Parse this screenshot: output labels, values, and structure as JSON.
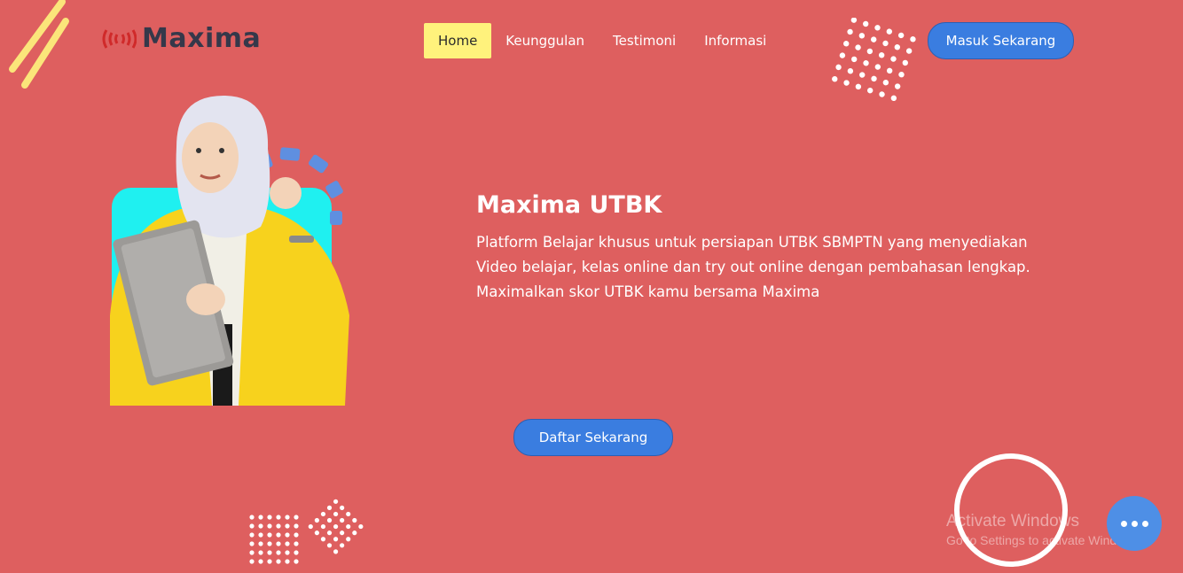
{
  "brand": {
    "name": "Maxima",
    "logo_icon": "sound-wave-icon"
  },
  "nav": {
    "items": [
      {
        "label": "Home",
        "active": true
      },
      {
        "label": "Keunggulan",
        "active": false
      },
      {
        "label": "Testimoni",
        "active": false
      },
      {
        "label": "Informasi",
        "active": false
      }
    ]
  },
  "header": {
    "login_label": "Masuk Sekarang"
  },
  "hero": {
    "title": "Maxima UTBK",
    "description": "Platform Belajar khusus untuk persiapan UTBK SBMPTN yang menyediakan Video belajar, kelas online dan try out online dengan pembahasan lengkap. Maximalkan skor UTBK kamu bersama Maxima",
    "cta_label": "Daftar Sekarang"
  },
  "watermark": {
    "line1": "Activate Windows",
    "line2": "Go to Settings to activate Windows."
  },
  "chat": {
    "icon": "more-dots-icon"
  },
  "colors": {
    "background": "#de5f5f",
    "accent_yellow": "#fff27c",
    "button_blue": "#3a7de0",
    "logo_dark": "#35384a",
    "logo_red": "#d02a2a",
    "illustration_cyan": "#1ff0f0"
  }
}
